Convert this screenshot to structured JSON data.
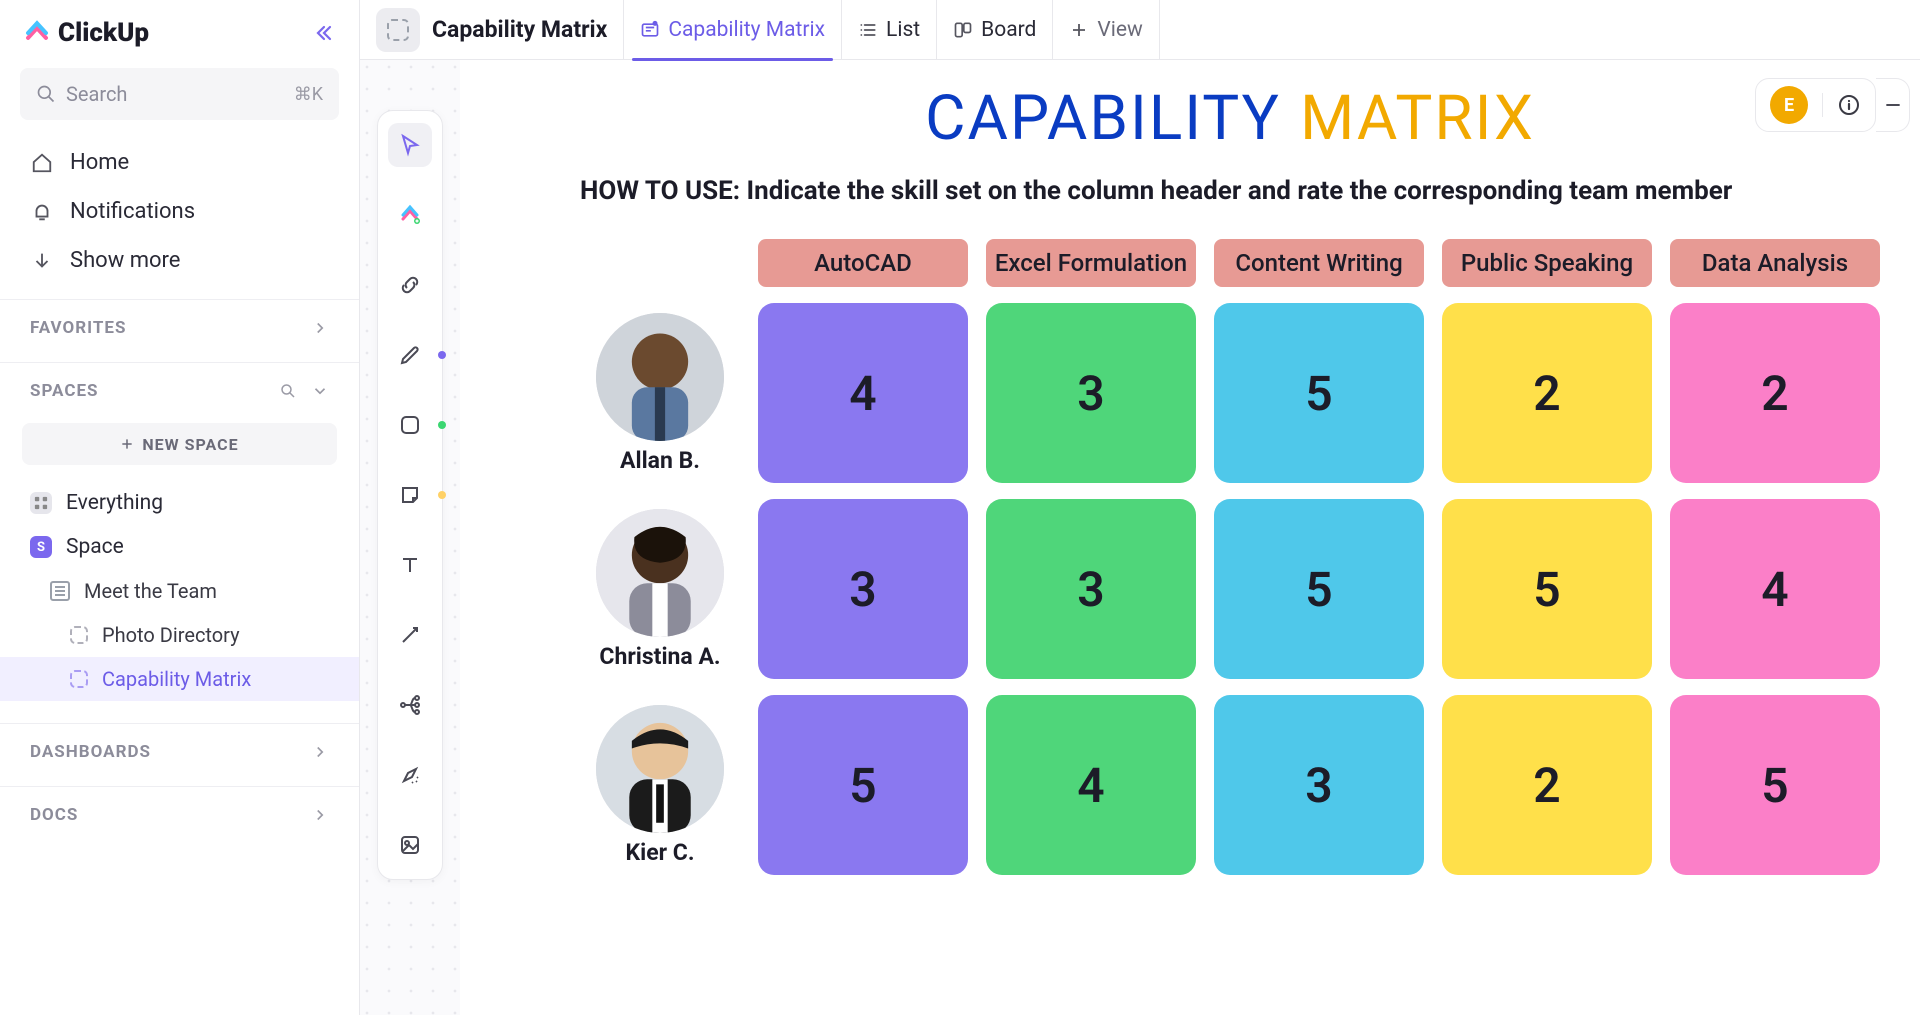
{
  "app": {
    "name": "ClickUp"
  },
  "search": {
    "placeholder": "Search",
    "shortcut": "⌘K"
  },
  "nav": {
    "home": "Home",
    "notifications": "Notifications",
    "showmore": "Show more"
  },
  "sections": {
    "favorites": "FAVORITES",
    "spaces": "SPACES",
    "dashboards": "DASHBOARDS",
    "docs": "DOCS"
  },
  "newspace": "NEW SPACE",
  "tree": {
    "everything": "Everything",
    "space": "Space",
    "space_letter": "S",
    "meet": "Meet the Team",
    "photo": "Photo Directory",
    "capability": "Capability Matrix"
  },
  "topbar": {
    "title": "Capability Matrix",
    "tab_cm": "Capability Matrix",
    "tab_list": "List",
    "tab_board": "Board",
    "tab_view": "View"
  },
  "user_initial": "E",
  "title": {
    "a": "CAPABILITY",
    "b": "MATRIX"
  },
  "howto": "HOW TO USE: Indicate the skill set on the column header and rate the corresponding team member",
  "skills": [
    "AutoCAD",
    "Excel Formulation",
    "Content Writing",
    "Public Speaking",
    "Data Analysis"
  ],
  "people": [
    {
      "name": "Allan B.",
      "ratings": [
        4,
        3,
        5,
        2,
        2
      ]
    },
    {
      "name": "Christina A.",
      "ratings": [
        3,
        3,
        5,
        5,
        4
      ]
    },
    {
      "name": "Kier C.",
      "ratings": [
        5,
        4,
        3,
        2,
        5
      ]
    }
  ],
  "colors": [
    "c-purple",
    "c-green",
    "c-blue",
    "c-yellow",
    "c-pink"
  ]
}
